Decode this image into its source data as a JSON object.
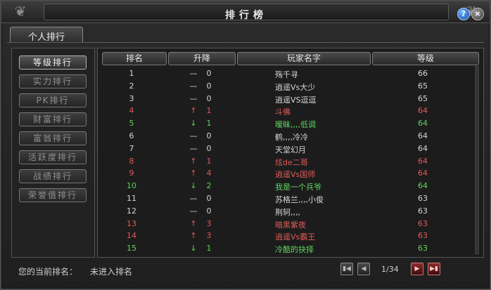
{
  "window": {
    "title": "排行榜"
  },
  "tabs": [
    {
      "label": "个人排行"
    }
  ],
  "sidebar": {
    "items": [
      {
        "label": "等级排行",
        "active": true
      },
      {
        "label": "实力排行",
        "active": false
      },
      {
        "label": "PK排行",
        "active": false
      },
      {
        "label": "财富排行",
        "active": false
      },
      {
        "label": "富翁排行",
        "active": false
      },
      {
        "label": "活跃度排行",
        "active": false
      },
      {
        "label": "战绩排行",
        "active": false
      },
      {
        "label": "荣誉值排行",
        "active": false
      }
    ]
  },
  "table": {
    "headers": {
      "rank": "排名",
      "change": "升降",
      "name": "玩家名字",
      "level": "等级"
    },
    "rows": [
      {
        "rank": "1",
        "trend": "same",
        "delta": "0",
        "name": "殇千寻",
        "level": "66",
        "color": "white"
      },
      {
        "rank": "2",
        "trend": "same",
        "delta": "0",
        "name": "逍遥Vs大少",
        "level": "65",
        "color": "white"
      },
      {
        "rank": "3",
        "trend": "same",
        "delta": "0",
        "name": "逍遥VS逗逗",
        "level": "65",
        "color": "white"
      },
      {
        "rank": "4",
        "trend": "up",
        "delta": "1",
        "name": "斗佛",
        "level": "64",
        "color": "red"
      },
      {
        "rank": "5",
        "trend": "down",
        "delta": "1",
        "name": "暧昧,,,,低调",
        "level": "64",
        "color": "green"
      },
      {
        "rank": "6",
        "trend": "same",
        "delta": "0",
        "name": "鹤,,,,冷冷",
        "level": "64",
        "color": "white"
      },
      {
        "rank": "7",
        "trend": "same",
        "delta": "0",
        "name": "天堂幻月",
        "level": "64",
        "color": "white"
      },
      {
        "rank": "8",
        "trend": "up",
        "delta": "1",
        "name": "炫de二哥",
        "level": "64",
        "color": "red"
      },
      {
        "rank": "9",
        "trend": "up",
        "delta": "4",
        "name": "逍遥Vs国师",
        "level": "64",
        "color": "red"
      },
      {
        "rank": "10",
        "trend": "down",
        "delta": "2",
        "name": "我是一个兵爷",
        "level": "64",
        "color": "green"
      },
      {
        "rank": "11",
        "trend": "same",
        "delta": "0",
        "name": "苏格兰,,,,小俊",
        "level": "63",
        "color": "white"
      },
      {
        "rank": "12",
        "trend": "same",
        "delta": "0",
        "name": "荆轲,,,,",
        "level": "63",
        "color": "white"
      },
      {
        "rank": "13",
        "trend": "up",
        "delta": "3",
        "name": "暗黑紫夜",
        "level": "63",
        "color": "red"
      },
      {
        "rank": "14",
        "trend": "up",
        "delta": "3",
        "name": "逍遥Vs霸王",
        "level": "63",
        "color": "red"
      },
      {
        "rank": "15",
        "trend": "down",
        "delta": "1",
        "name": "冷酷的抉择",
        "level": "63",
        "color": "green"
      }
    ]
  },
  "footer": {
    "current_rank_label": "您的当前排名：",
    "current_rank_value": "未进入排名",
    "page_text": "1/34"
  },
  "icons": {
    "help": "help-icon",
    "close": "close-icon",
    "first": "first-page-icon",
    "prev": "prev-page-icon",
    "next": "next-page-icon",
    "last": "last-page-icon",
    "up": "up-arrow-icon",
    "down": "down-arrow-icon",
    "same": "dash-icon"
  },
  "trend_symbols": {
    "same": "—",
    "up": "↑",
    "down": "↓"
  }
}
